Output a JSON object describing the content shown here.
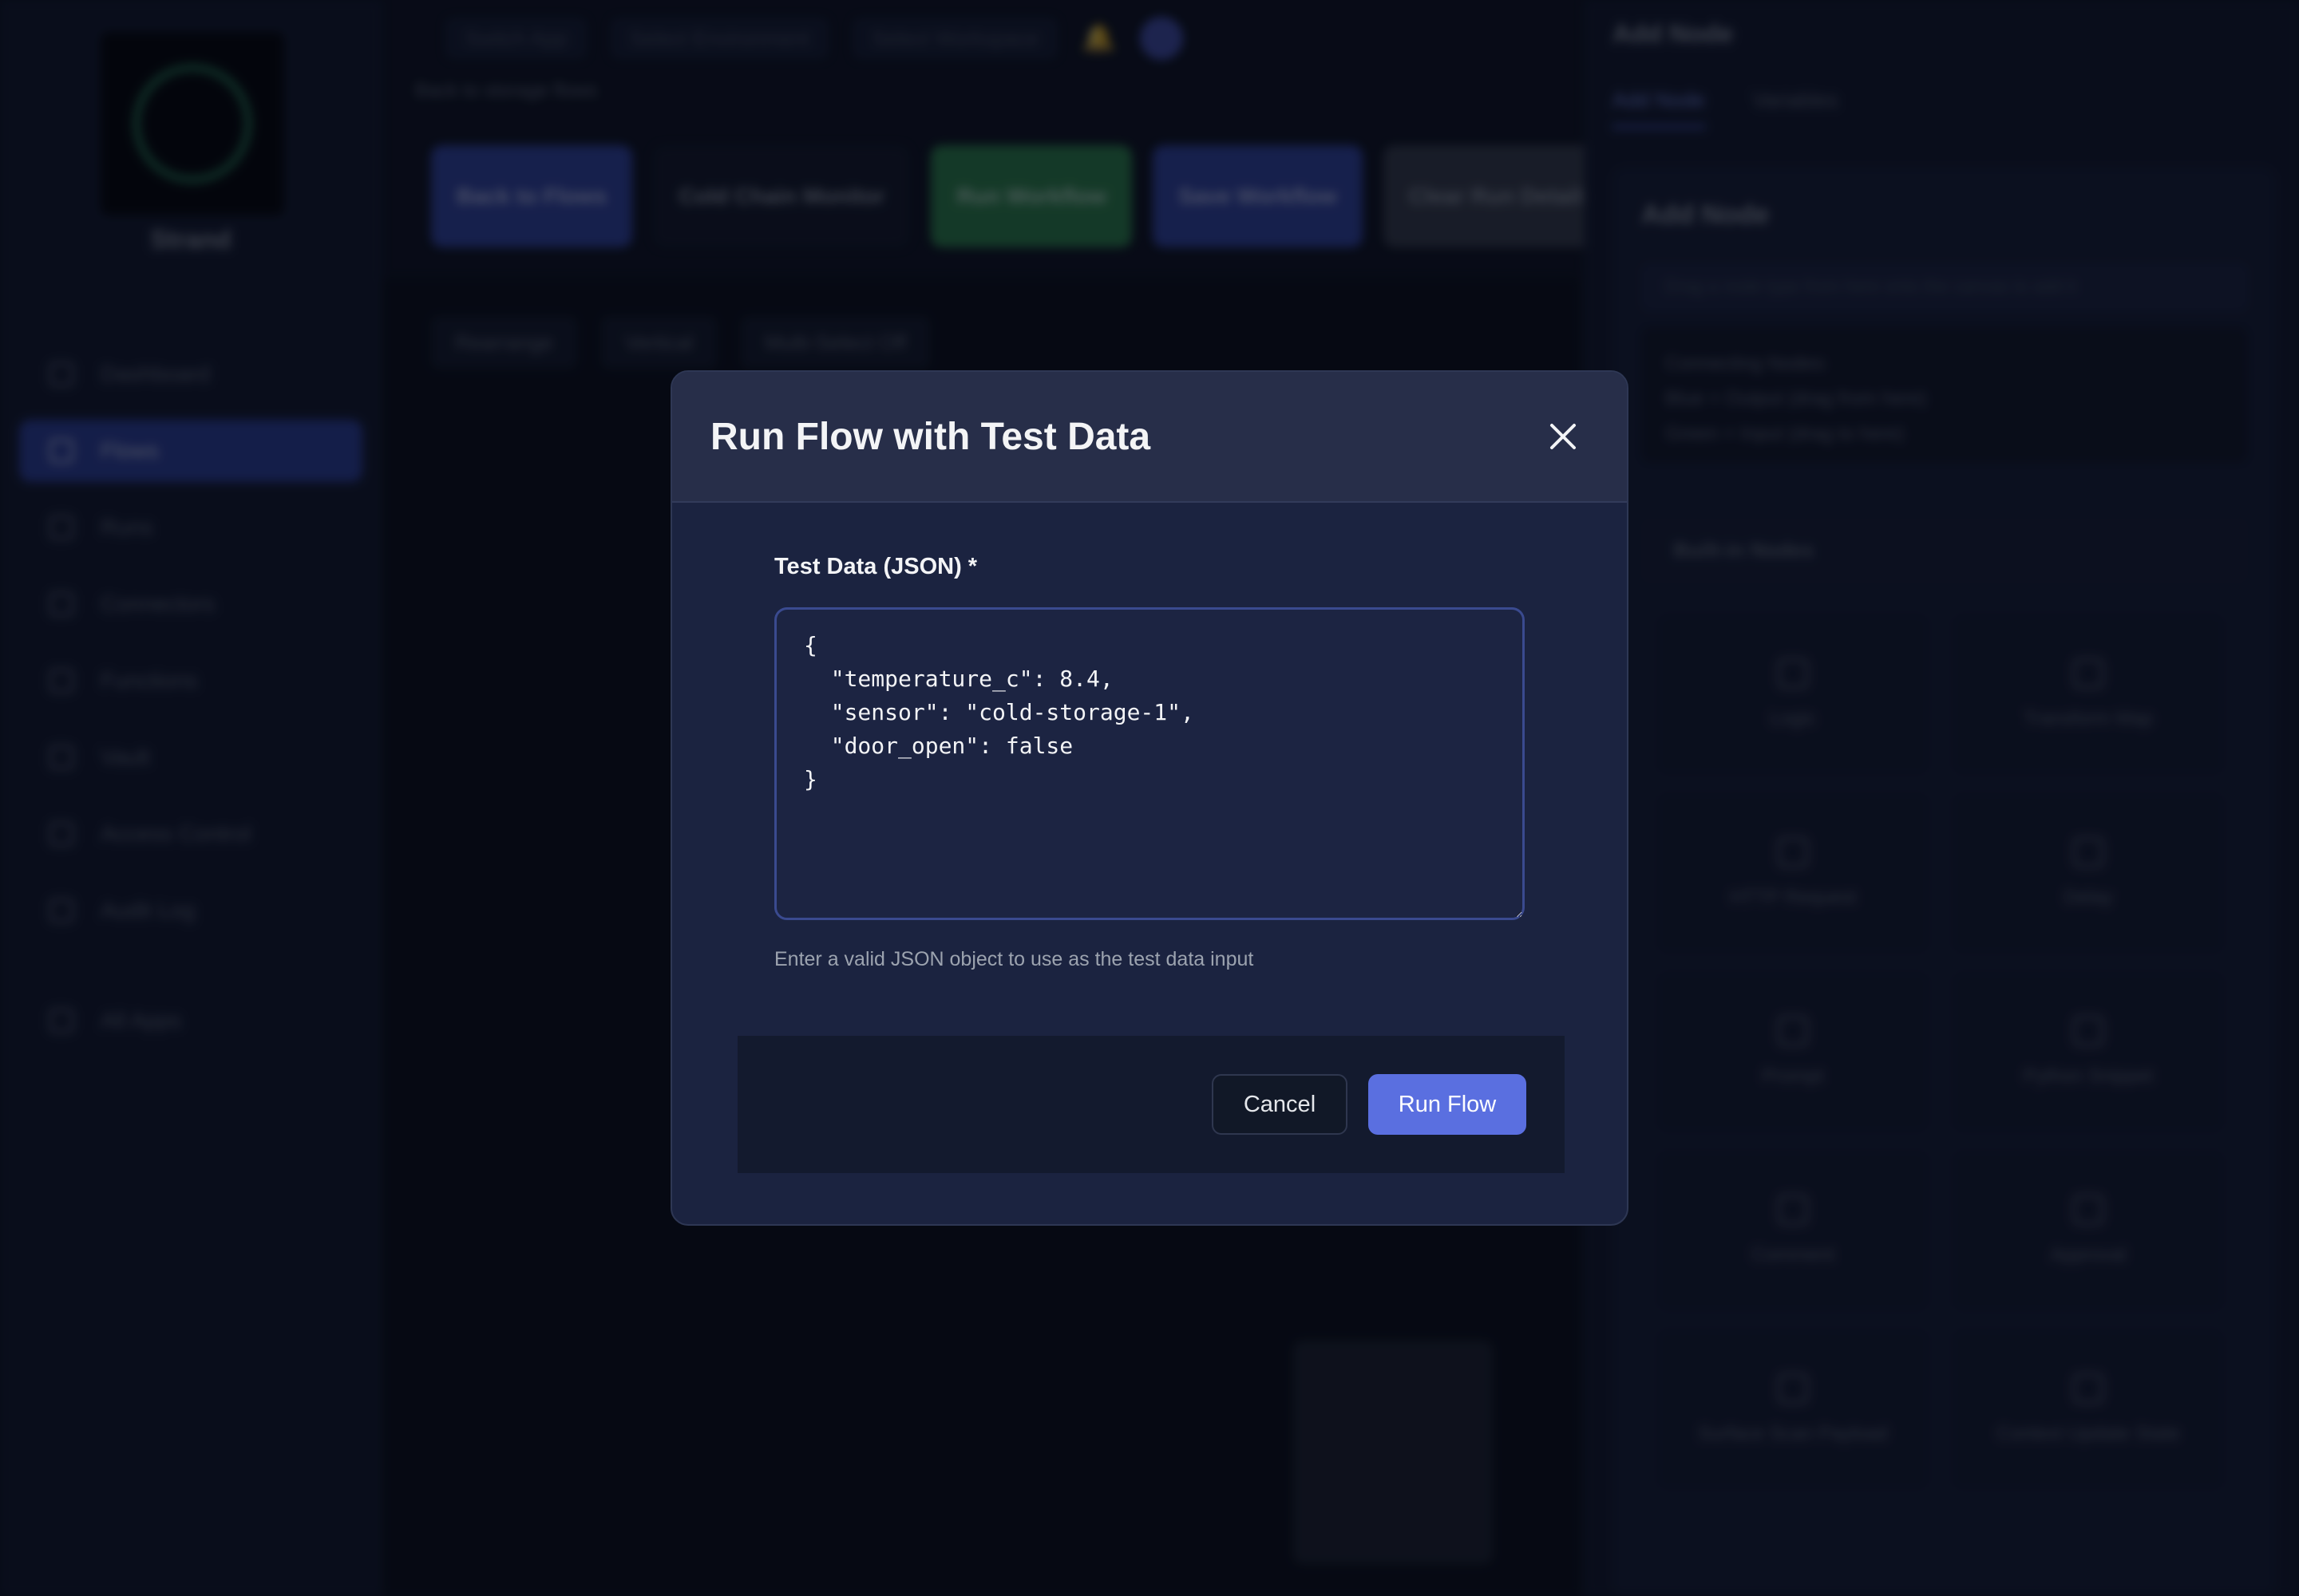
{
  "app": {
    "brand_name": "Strand",
    "nav": [
      {
        "label": "Dashboard",
        "icon": "grid-icon"
      },
      {
        "label": "Flows",
        "icon": "flow-icon",
        "active": true
      },
      {
        "label": "Runs",
        "icon": "play-icon"
      },
      {
        "label": "Connectors",
        "icon": "plug-icon"
      },
      {
        "label": "Functions",
        "icon": "function-icon"
      },
      {
        "label": "Vault",
        "icon": "lock-icon"
      },
      {
        "label": "Access Control",
        "icon": "key-icon"
      },
      {
        "label": "Audit Log",
        "icon": "log-icon"
      },
      {
        "label": "All Apps",
        "icon": "apps-icon"
      }
    ],
    "topbar": {
      "switch_app": "Switch App",
      "select_a": "Select Environment",
      "select_b": "Select Workspace"
    },
    "breadcrumb": "Back to storage flows",
    "toolbar": {
      "back": "Back to Flows",
      "flow_name": "Cold Chain Monitor",
      "run": "Run Workflow",
      "save": "Save Workflow",
      "clear": "Clear Run Details"
    },
    "canvas_tools": [
      "Rearrange",
      "Vertical",
      "Multi-Select Off"
    ]
  },
  "right_panel": {
    "title": "Add Node",
    "tabs": [
      "Add Node",
      "Variables"
    ],
    "heading": "Add Node",
    "hint": "Drag a node type from here onto the canvas to add it",
    "connecting_title": "Connecting Nodes:",
    "connecting_lines": [
      "Blue = Output (drag from here)",
      "Green = Input (drag to here)"
    ],
    "section": "Built-in Nodes",
    "nodes": [
      "Logic",
      "Transform Map",
      "HTTP Request",
      "Delay",
      "Prompt",
      "Python Snippet",
      "Comment",
      "Approval",
      "Surface Scan Payload",
      "Context Update State"
    ]
  },
  "modal": {
    "title": "Run Flow with Test Data",
    "field_label": "Test Data (JSON) *",
    "json_value": "{\n  \"temperature_c\": 8.4,\n  \"sensor\": \"cold-storage-1\",\n  \"door_open\": false\n}",
    "help_text": "Enter a valid JSON object to use as the test data input",
    "cancel_label": "Cancel",
    "run_label": "Run Flow"
  },
  "colors": {
    "accent": "#5a6fe0",
    "modal_bg": "#1b2340",
    "modal_header_bg": "#272e49",
    "footer_bg": "#131a2e",
    "input_border": "#3a4a8f"
  }
}
